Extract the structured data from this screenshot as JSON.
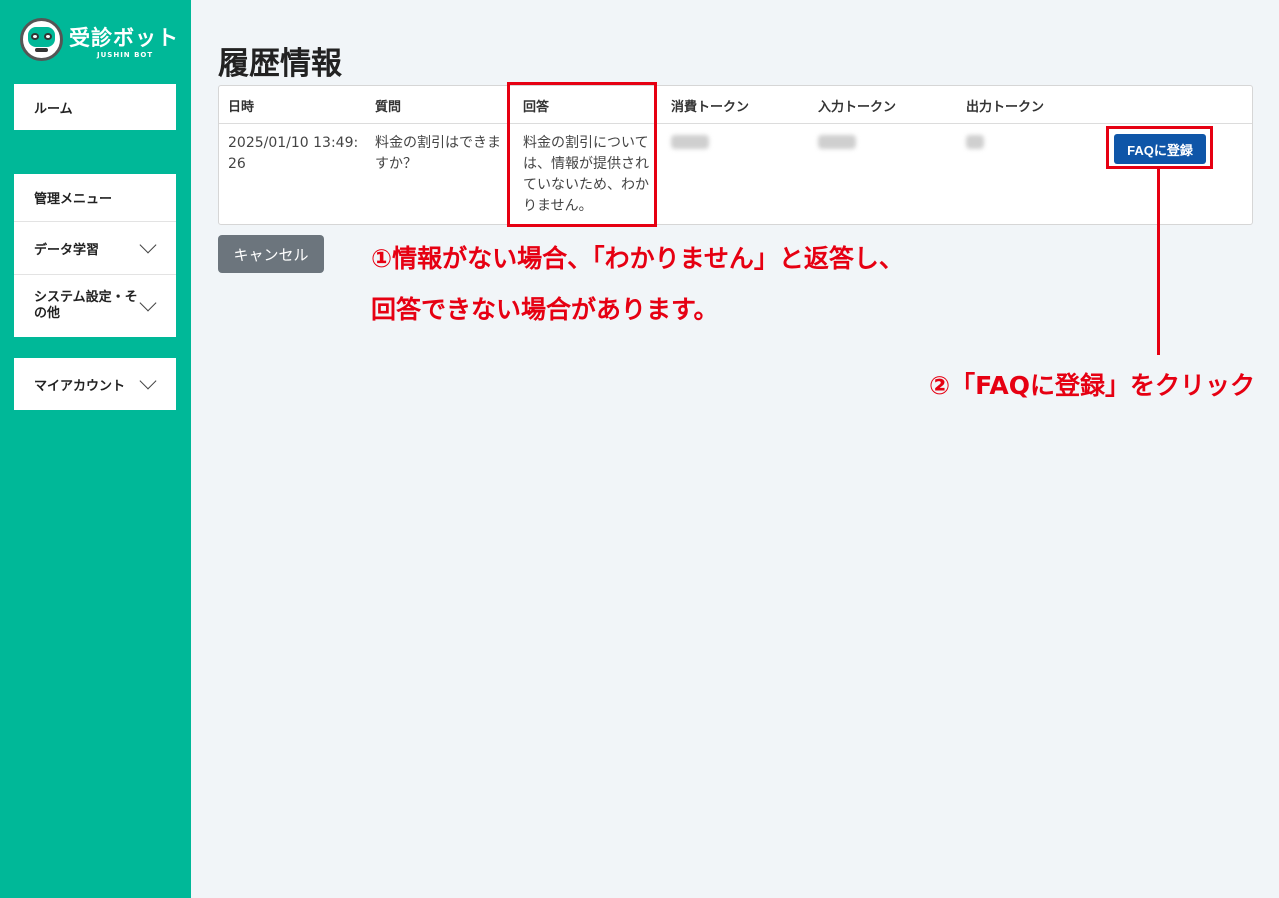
{
  "app": {
    "logo_text": "受診ボット",
    "logo_sub": "JUSHIN BOT"
  },
  "sidebar": {
    "room": "ルーム",
    "admin_menu": "管理メニュー",
    "data_learning": "データ学習",
    "system_settings": "システム設定・その他",
    "my_account": "マイアカウント"
  },
  "page": {
    "title": "履歴情報"
  },
  "table": {
    "headers": [
      "日時",
      "質問",
      "回答",
      "消費トークン",
      "入力トークン",
      "出力トークン"
    ],
    "rows": [
      {
        "datetime": "2025/01/10 13:49:26",
        "question": "料金の割引はできますか？",
        "answer": "料金の割引については、情報が提供されていないため、わかりません。",
        "faq_button": "FAQに登録"
      }
    ]
  },
  "buttons": {
    "cancel": "キャンセル"
  },
  "annotations": {
    "note1_line1": "①情報がない場合、「わかりません」と返答し、",
    "note1_line2": "回答できない場合があります。",
    "note2": "②「FAQに登録」をクリック",
    "color": "#e60012"
  },
  "colors": {
    "sidebar": "#00b898",
    "primary_button": "#0f56a8",
    "cancel_button": "#6c757d"
  }
}
